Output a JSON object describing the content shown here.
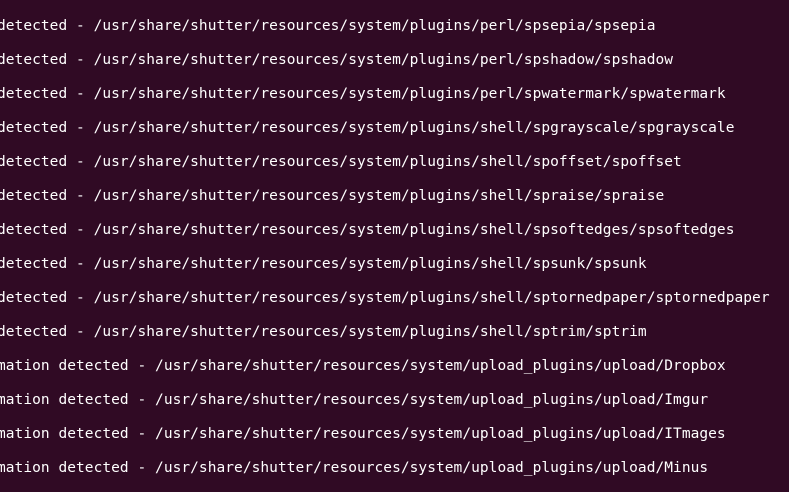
{
  "terminal": {
    "background": "#300a24",
    "foreground": "#ffffff",
    "lines": [
      "detected - /usr/share/shutter/resources/system/plugins/perl/spsepia/spsepia",
      "detected - /usr/share/shutter/resources/system/plugins/perl/spshadow/spshadow",
      "detected - /usr/share/shutter/resources/system/plugins/perl/spwatermark/spwatermark",
      "detected - /usr/share/shutter/resources/system/plugins/shell/spgrayscale/spgrayscale",
      "detected - /usr/share/shutter/resources/system/plugins/shell/spoffset/spoffset",
      "detected - /usr/share/shutter/resources/system/plugins/shell/spraise/spraise",
      "detected - /usr/share/shutter/resources/system/plugins/shell/spsoftedges/spsoftedges",
      "detected - /usr/share/shutter/resources/system/plugins/shell/spsunk/spsunk",
      "detected - /usr/share/shutter/resources/system/plugins/shell/sptornedpaper/sptornedpaper",
      "detected - /usr/share/shutter/resources/system/plugins/shell/sptrim/sptrim",
      "mation detected - /usr/share/shutter/resources/system/upload_plugins/upload/Dropbox",
      "mation detected - /usr/share/shutter/resources/system/upload_plugins/upload/Imgur",
      "mation detected - /usr/share/shutter/resources/system/upload_plugins/upload/ITmages",
      "mation detected - /usr/share/shutter/resources/system/upload_plugins/upload/Minus"
    ]
  }
}
